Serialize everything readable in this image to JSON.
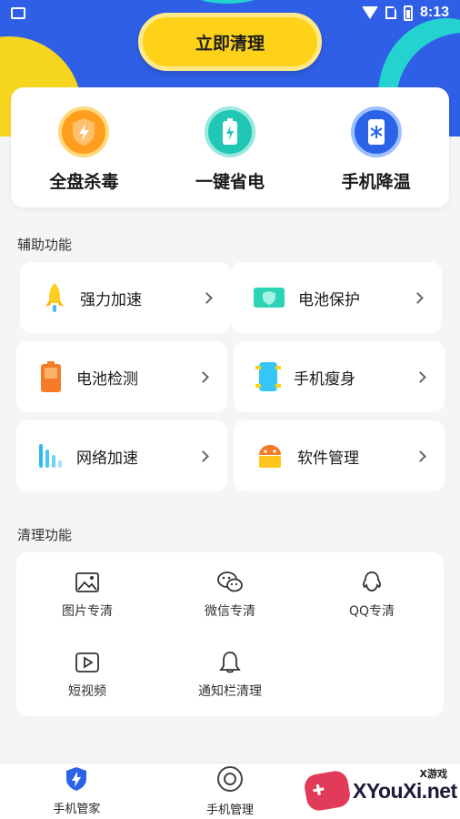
{
  "status_bar": {
    "time": "8:13"
  },
  "hero": {
    "clean_button": "立即清理"
  },
  "top_features": [
    {
      "label": "全盘杀毒",
      "icon": "virus-shield-icon"
    },
    {
      "label": "一键省电",
      "icon": "battery-power-icon"
    },
    {
      "label": "手机降温",
      "icon": "phone-cool-icon"
    }
  ],
  "assist": {
    "title": "辅助功能",
    "items": [
      {
        "label": "强力加速",
        "icon": "rocket-icon"
      },
      {
        "label": "电池保护",
        "icon": "battery-shield-icon"
      },
      {
        "label": "电池检测",
        "icon": "battery-check-icon"
      },
      {
        "label": "手机瘦身",
        "icon": "phone-slim-icon"
      },
      {
        "label": "网络加速",
        "icon": "signal-bars-icon"
      },
      {
        "label": "软件管理",
        "icon": "android-icon"
      }
    ]
  },
  "cleanup": {
    "title": "清理功能",
    "items": [
      {
        "label": "图片专清",
        "icon": "image-icon"
      },
      {
        "label": "微信专清",
        "icon": "wechat-icon"
      },
      {
        "label": "QQ专清",
        "icon": "qq-icon"
      },
      {
        "label": "短视频",
        "icon": "play-icon"
      },
      {
        "label": "通知栏清理",
        "icon": "bell-icon"
      }
    ]
  },
  "bottom_nav": [
    {
      "label": "手机管家",
      "icon": "shield-bolt-icon",
      "active": true
    },
    {
      "label": "手机管理",
      "icon": "circle-target-icon",
      "active": false
    }
  ],
  "watermark": {
    "brand": "XYouXi.net",
    "tag": "X游戏"
  },
  "colors": {
    "hero_blue": "#2f5fe6",
    "button_yellow": "#ffd21a",
    "accent_teal": "#24d2cf"
  }
}
